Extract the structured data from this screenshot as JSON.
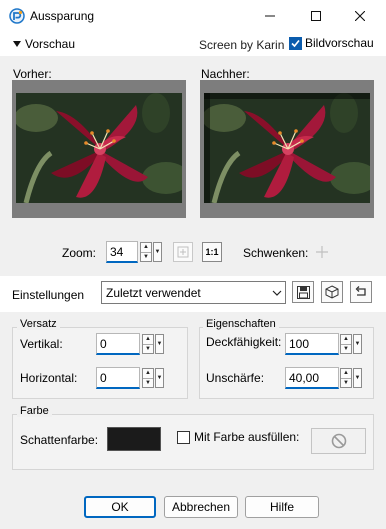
{
  "window": {
    "title": "Aussparung"
  },
  "preview": {
    "toggle_label": "Vorschau",
    "credit": "Screen by Karin",
    "bildvorschau_label": "Bildvorschau",
    "bildvorschau_checked": true,
    "before_label": "Vorher:",
    "after_label": "Nachher:"
  },
  "zoom": {
    "label": "Zoom:",
    "value": "34",
    "pan_label": "Schwenken:"
  },
  "settings": {
    "label": "Einstellungen",
    "preset": "Zuletzt verwendet"
  },
  "versatz": {
    "title": "Versatz",
    "vertical_label": "Vertikal:",
    "vertical_value": "0",
    "horizontal_label": "Horizontal:",
    "horizontal_value": "0"
  },
  "eigenschaften": {
    "title": "Eigenschaften",
    "opacity_label": "Deckfähigkeit:",
    "opacity_value": "100",
    "blur_label": "Unschärfe:",
    "blur_value": "40,00"
  },
  "farbe": {
    "title": "Farbe",
    "shadow_label": "Schattenfarbe:",
    "shadow_color": "#1b1b1b",
    "fill_label": "Mit Farbe ausfüllen:",
    "fill_checked": false
  },
  "buttons": {
    "ok": "OK",
    "cancel": "Abbrechen",
    "help": "Hilfe"
  }
}
